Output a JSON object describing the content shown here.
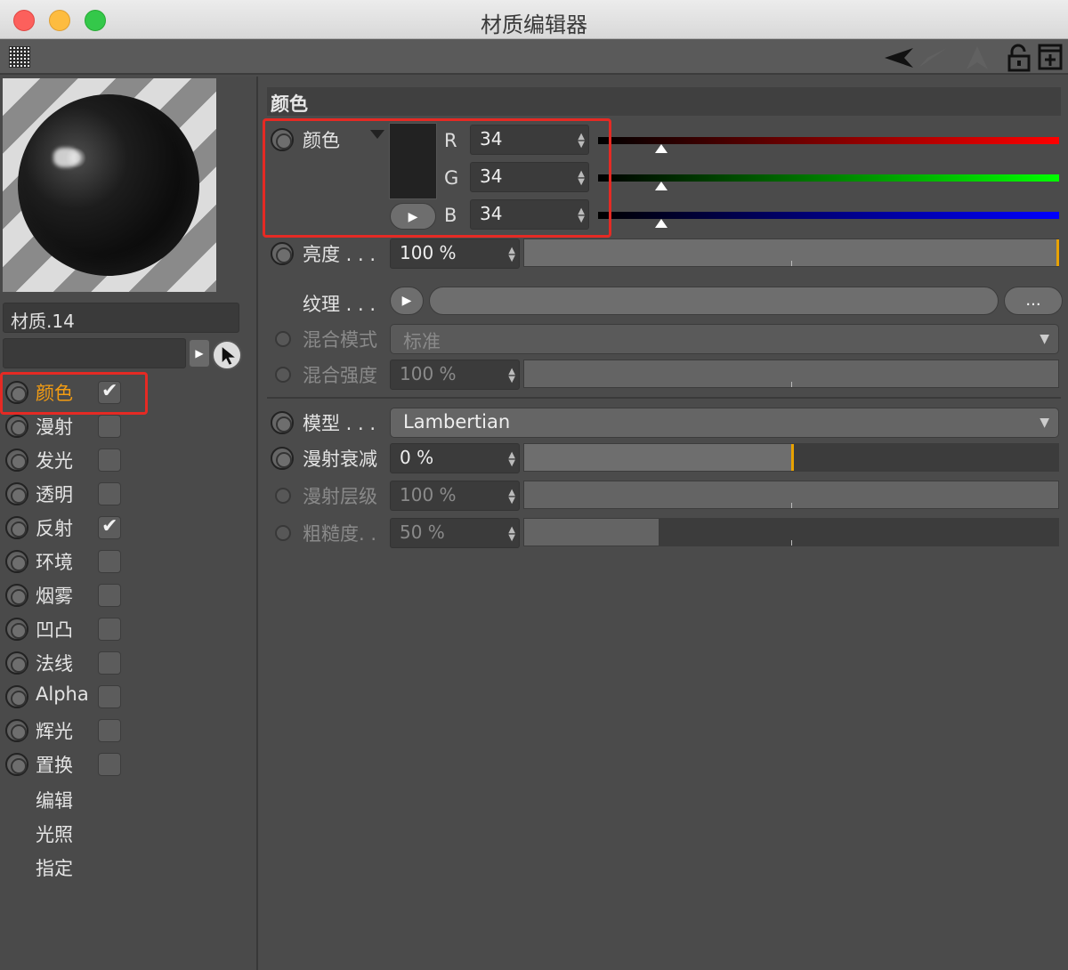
{
  "window": {
    "title": "材质编辑器"
  },
  "material": {
    "name": "材质.14"
  },
  "channels": [
    {
      "label": "颜色",
      "checked": true,
      "active": true
    },
    {
      "label": "漫射",
      "checked": false
    },
    {
      "label": "发光",
      "checked": false
    },
    {
      "label": "透明",
      "checked": false
    },
    {
      "label": "反射",
      "checked": true
    },
    {
      "label": "环境",
      "checked": false
    },
    {
      "label": "烟雾",
      "checked": false
    },
    {
      "label": "凹凸",
      "checked": false
    },
    {
      "label": "法线",
      "checked": false
    },
    {
      "label": "Alpha",
      "checked": false
    },
    {
      "label": "辉光",
      "checked": false
    },
    {
      "label": "置换",
      "checked": false
    }
  ],
  "extra_items": [
    "编辑",
    "光照",
    "指定"
  ],
  "color_section": {
    "header": "颜色",
    "color_label": "颜色",
    "swatch_color": "#222222",
    "r_label": "R",
    "r_value": "34",
    "g_label": "G",
    "g_value": "34",
    "b_label": "B",
    "b_value": "34",
    "brightness_label": "亮度 . . .",
    "brightness_value": "100 %",
    "texture_label": "纹理 . . .",
    "texture_more": "...",
    "blend_mode_label": "混合模式",
    "blend_mode_value": "标准",
    "blend_strength_label": "混合强度",
    "blend_strength_value": "100 %"
  },
  "model_section": {
    "model_label": "模型 . . .",
    "model_value": "Lambertian",
    "diffuse_falloff_label": "漫射衰减",
    "diffuse_falloff_value": "0 %",
    "diffuse_level_label": "漫射层级",
    "diffuse_level_value": "100 %",
    "roughness_label": "粗糙度. .",
    "roughness_value": "50 %"
  },
  "accent_colors": {
    "highlight": "#e52a24",
    "active_label": "#f39c12",
    "slider_marker": "#e8a200"
  }
}
